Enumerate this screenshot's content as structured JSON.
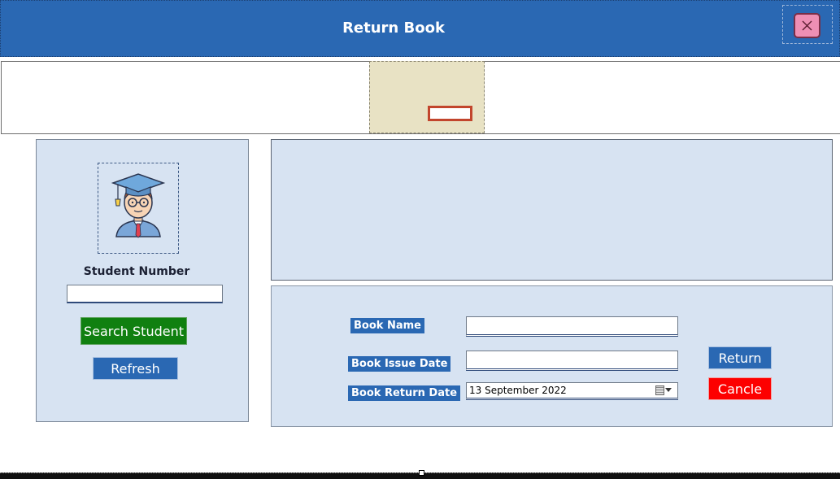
{
  "window": {
    "title": "Return Book",
    "close_icon": "close-icon"
  },
  "student": {
    "number_label": "Student Number",
    "number_value": "",
    "search_label": "Search Student",
    "refresh_label": "Refresh",
    "avatar_icon": "graduate-avatar-icon"
  },
  "book_form": {
    "book_name_label": "Book Name",
    "book_name_value": "",
    "issue_date_label": "Book Issue Date",
    "issue_date_value": "",
    "return_date_label": "Book Return Date",
    "return_date_value": "13 September 2022",
    "return_label": "Return",
    "cancel_label": "Cancle"
  },
  "colors": {
    "accent": "#2a68b3",
    "panel": "#d7e3f2",
    "search_button": "#108010",
    "cancel_button": "#fd0000",
    "close_button": "#ee8fb4"
  }
}
